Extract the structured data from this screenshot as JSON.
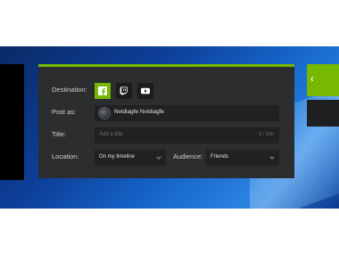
{
  "dialog": {
    "accent_color": "#76b900",
    "destination": {
      "label": "Destination:",
      "options": [
        {
          "name": "facebook",
          "icon": "facebook-icon",
          "selected": true
        },
        {
          "name": "twitch",
          "icon": "twitch-icon",
          "selected": false
        },
        {
          "name": "youtube",
          "icon": "youtube-icon",
          "selected": false
        }
      ]
    },
    "post_as": {
      "label": "Post as:",
      "user_name": "Nvidiagfe Nvidiagfe"
    },
    "title": {
      "label": "Title:",
      "placeholder": "Add a title",
      "counter": "0 / 100"
    },
    "location": {
      "label": "Location:",
      "value": "On my timeline"
    },
    "audience": {
      "label": "Audience:",
      "value": "Friends"
    }
  }
}
